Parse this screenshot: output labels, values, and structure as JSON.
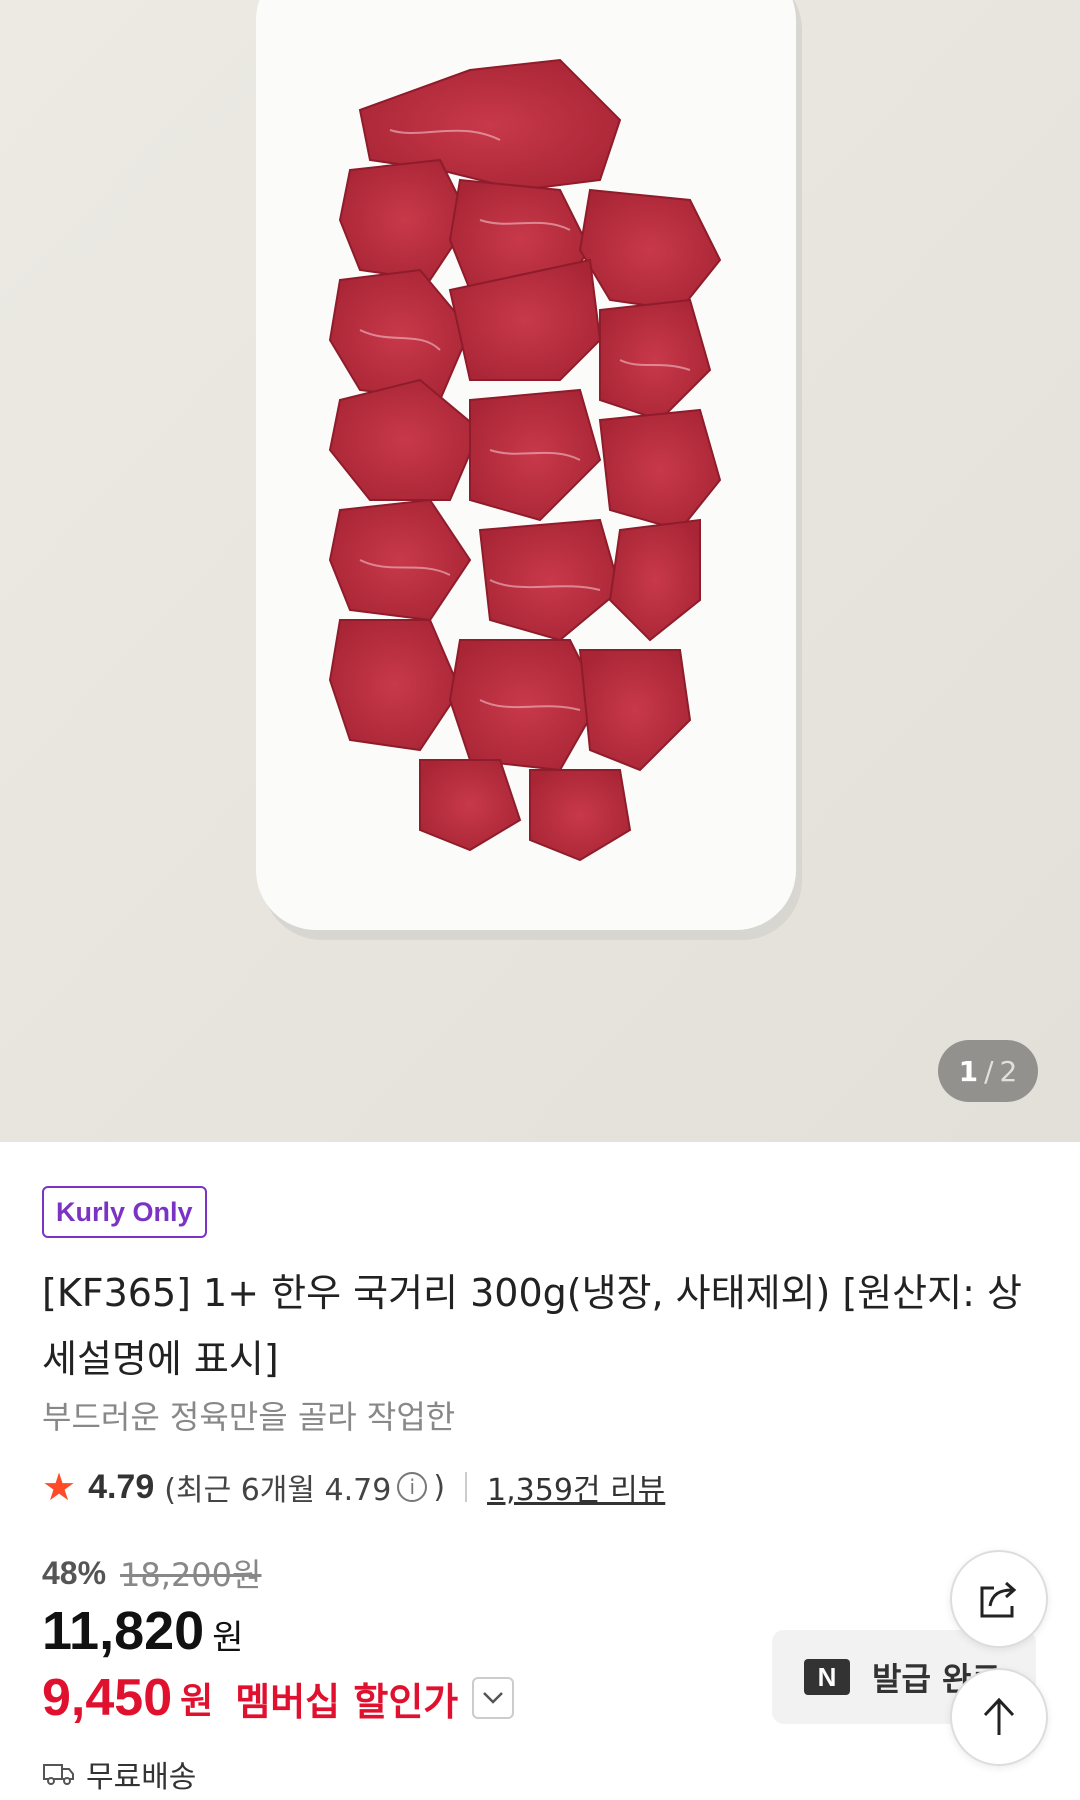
{
  "gallery": {
    "current": "1",
    "separator": "/",
    "total": "2"
  },
  "product": {
    "badge": "Kurly Only",
    "title": "[KF365] 1+ 한우 국거리 300g(냉장, 사태제외) [원산지: 상세설명에 표시]",
    "subtitle": "부드러운 정육만을 골라 작업한"
  },
  "rating": {
    "score": "4.79",
    "recent_text": "(최근 6개월 4.79",
    "recent_close": ")",
    "info_glyph": "i",
    "reviews": "1,359건 리뷰"
  },
  "pricing": {
    "discount_rate": "48%",
    "original_price": "18,200원",
    "price": "11,820",
    "price_unit": "원",
    "member_price": "9,450",
    "member_unit": "원",
    "member_label": "멤버십 할인가"
  },
  "delivery": {
    "label": "무료배송"
  },
  "coupon": {
    "logo": "N",
    "label": "발급 완료"
  },
  "colors": {
    "accent_purple": "#7b33c4",
    "discount_red": "#e0102f",
    "star_orange": "#ff4b28"
  },
  "icons": {
    "share": "share-icon",
    "top": "arrow-up-icon",
    "chevron": "chevron-down-icon",
    "star": "star-icon",
    "truck": "truck-icon",
    "info": "info-icon"
  }
}
